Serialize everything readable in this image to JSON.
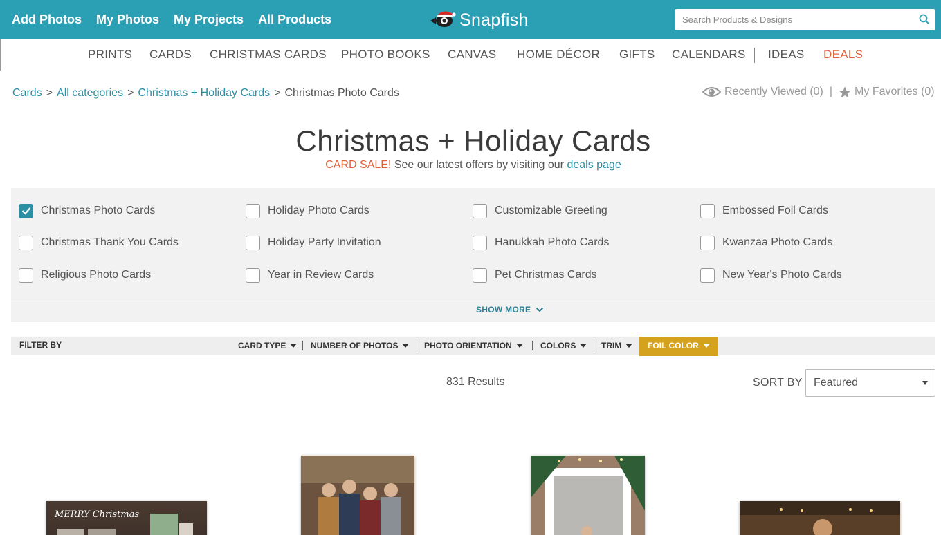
{
  "topnav": {
    "links": [
      "Add Photos",
      "My Photos",
      "My Projects",
      "All Products"
    ],
    "logo_text": "Snapfish",
    "search_placeholder": "Search Products & Designs"
  },
  "categories": [
    "PRINTS",
    "CARDS",
    "CHRISTMAS CARDS",
    "PHOTO BOOKS",
    "CANVAS",
    "HOME DÉCOR",
    "GIFTS",
    "CALENDARS",
    "IDEAS",
    "DEALS"
  ],
  "breadcrumb": {
    "items": [
      "Cards",
      "All categories",
      "Christmas + Holiday Cards"
    ],
    "current": "Christmas Photo Cards",
    "separator": ">"
  },
  "user_links": {
    "recently_viewed": "Recently Viewed (0)",
    "favorites": "My Favorites (0)",
    "separator": "|"
  },
  "header": {
    "title": "Christmas + Holiday Cards",
    "sale_label": "CARD SALE!",
    "sale_text": "See our latest offers by visiting our",
    "deals_link": "deals page"
  },
  "subcategories": [
    {
      "label": "Christmas Photo Cards",
      "checked": true
    },
    {
      "label": "Holiday Photo Cards",
      "checked": false
    },
    {
      "label": "Customizable Greeting",
      "checked": false
    },
    {
      "label": "Embossed Foil Cards",
      "checked": false
    },
    {
      "label": "Christmas Thank You Cards",
      "checked": false
    },
    {
      "label": "Holiday Party Invitation",
      "checked": false
    },
    {
      "label": "Hanukkah Photo Cards",
      "checked": false
    },
    {
      "label": "Kwanzaa Photo Cards",
      "checked": false
    },
    {
      "label": "Religious Photo Cards",
      "checked": false
    },
    {
      "label": "Year in Review Cards",
      "checked": false
    },
    {
      "label": "Pet Christmas Cards",
      "checked": false
    },
    {
      "label": "New Year's Photo Cards",
      "checked": false
    }
  ],
  "show_more": "SHOW MORE",
  "filters": {
    "label": "FILTER BY",
    "items": [
      "CARD TYPE",
      "NUMBER OF PHOTOS",
      "PHOTO ORIENTATION",
      "COLORS",
      "TRIM",
      "FOIL COLOR"
    ],
    "active": "FOIL COLOR"
  },
  "results": {
    "count_text": "831 Results",
    "sort_label": "SORT BY",
    "sort_value": "Featured"
  },
  "product_thumbs": {
    "card1_text": "MERRY Christmas"
  },
  "colors": {
    "brand_teal": "#2b9fb3",
    "deals_orange": "#e0623b",
    "active_filter": "#d4a21c",
    "link_teal": "#2b8fa3"
  }
}
